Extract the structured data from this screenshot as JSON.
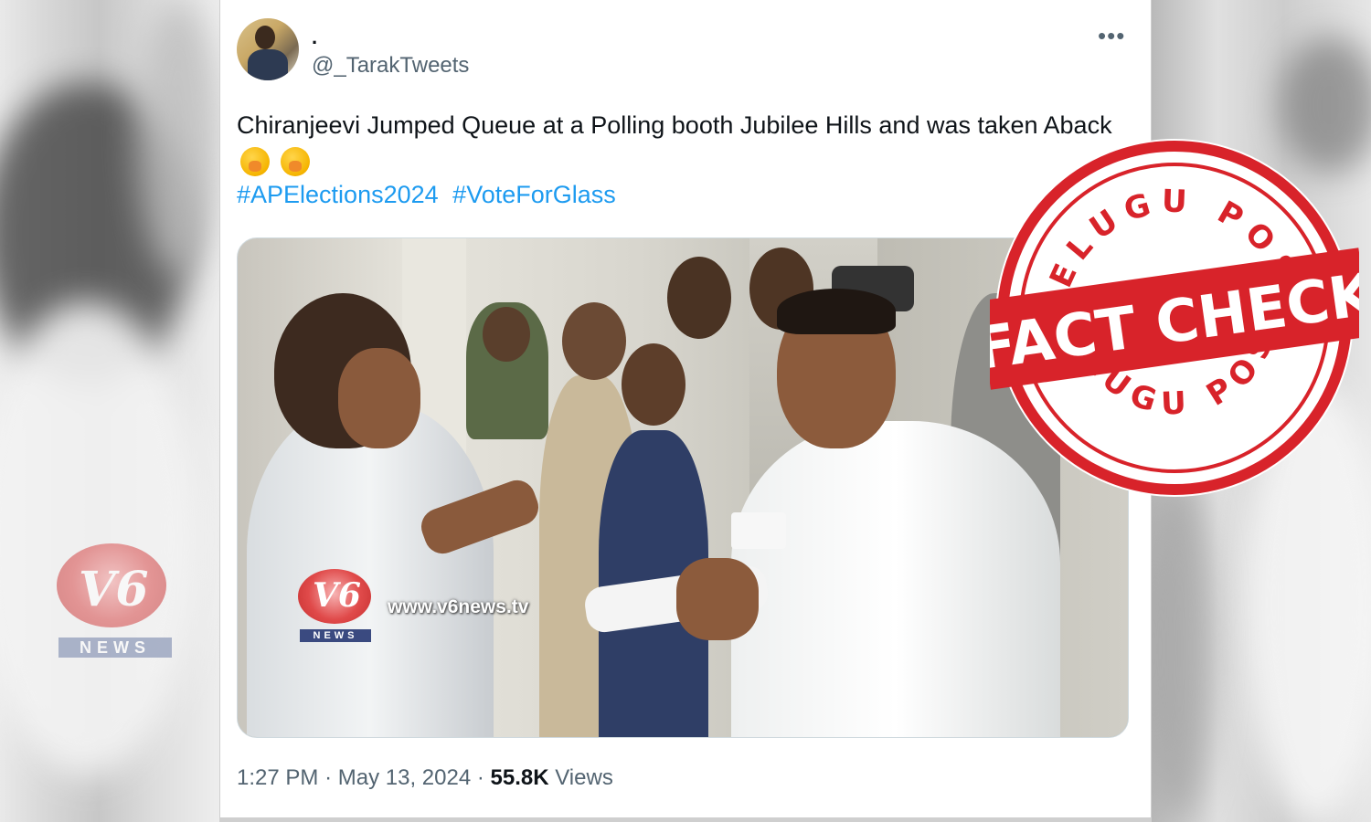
{
  "tweet": {
    "display_name": ".",
    "handle": "@_TarakTweets",
    "more_icon": "more-horizontal-icon",
    "text": "Chiranjeevi Jumped Queue at a Polling booth Jubilee Hills and was taken Aback",
    "emojis": [
      "hand-over-mouth-emoji",
      "hand-over-mouth-emoji"
    ],
    "hashtags": [
      "#APElections2024",
      "#VoteForGlass"
    ],
    "time": "1:27 PM",
    "separator": "·",
    "date": "May 13, 2024",
    "views_count": "55.8K",
    "views_label": "Views"
  },
  "video": {
    "logo_text": "V6",
    "logo_sub": "NEWS",
    "watermark_url": "www.v6news.tv"
  },
  "stamp": {
    "top_text": "TELUGU POST",
    "main_text": "FACT CHECK",
    "bottom_text": "TELUGU POST",
    "color": "#d8232a"
  }
}
